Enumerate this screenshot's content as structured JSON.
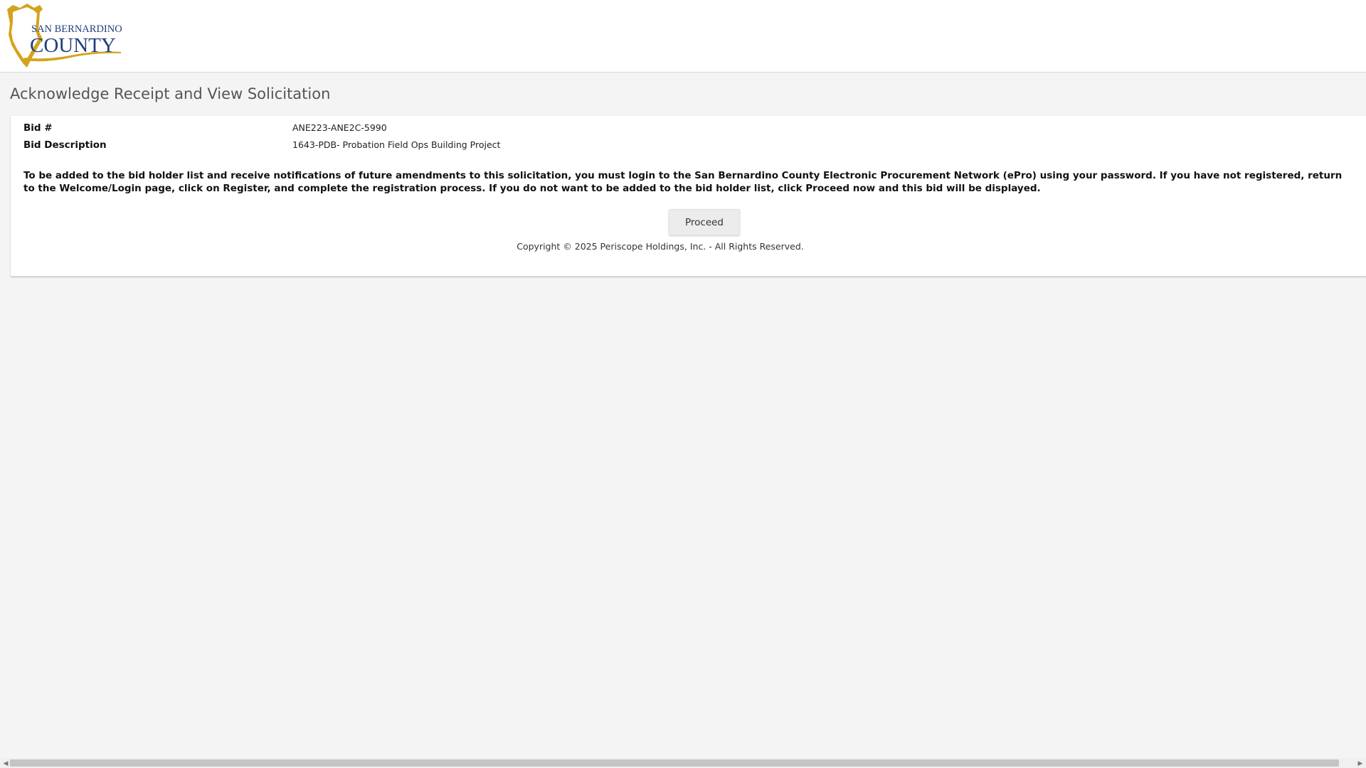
{
  "header": {
    "logo_top": "SAN BERNARDINO",
    "logo_bottom": "COUNTY",
    "logo_icon": "county-shield-icon",
    "logo_color": "#d4a21c",
    "logo_text_color": "#1f3f7a"
  },
  "page": {
    "title": "Acknowledge Receipt and View Solicitation"
  },
  "bid": {
    "number_label": "Bid #",
    "number_value": "ANE223-ANE2C-5990",
    "description_label": "Bid Description",
    "description_value": "1643-PDB- Probation Field Ops Building Project"
  },
  "notice": {
    "text": "To be added to the bid holder list and receive notifications of future amendments to this solicitation, you must login to the San Bernardino County Electronic Procurement Network (ePro) using your password. If you have not registered, return to the Welcome/Login page, click on Register, and complete the registration process. If you do not want to be added to the bid holder list, click Proceed now and this bid will be displayed."
  },
  "actions": {
    "proceed_label": "Proceed"
  },
  "footer": {
    "copyright": "Copyright © 2025 Periscope Holdings, Inc. - All Rights Reserved."
  },
  "scrollbar": {
    "left_arrow": "◀",
    "right_arrow": "▶"
  }
}
